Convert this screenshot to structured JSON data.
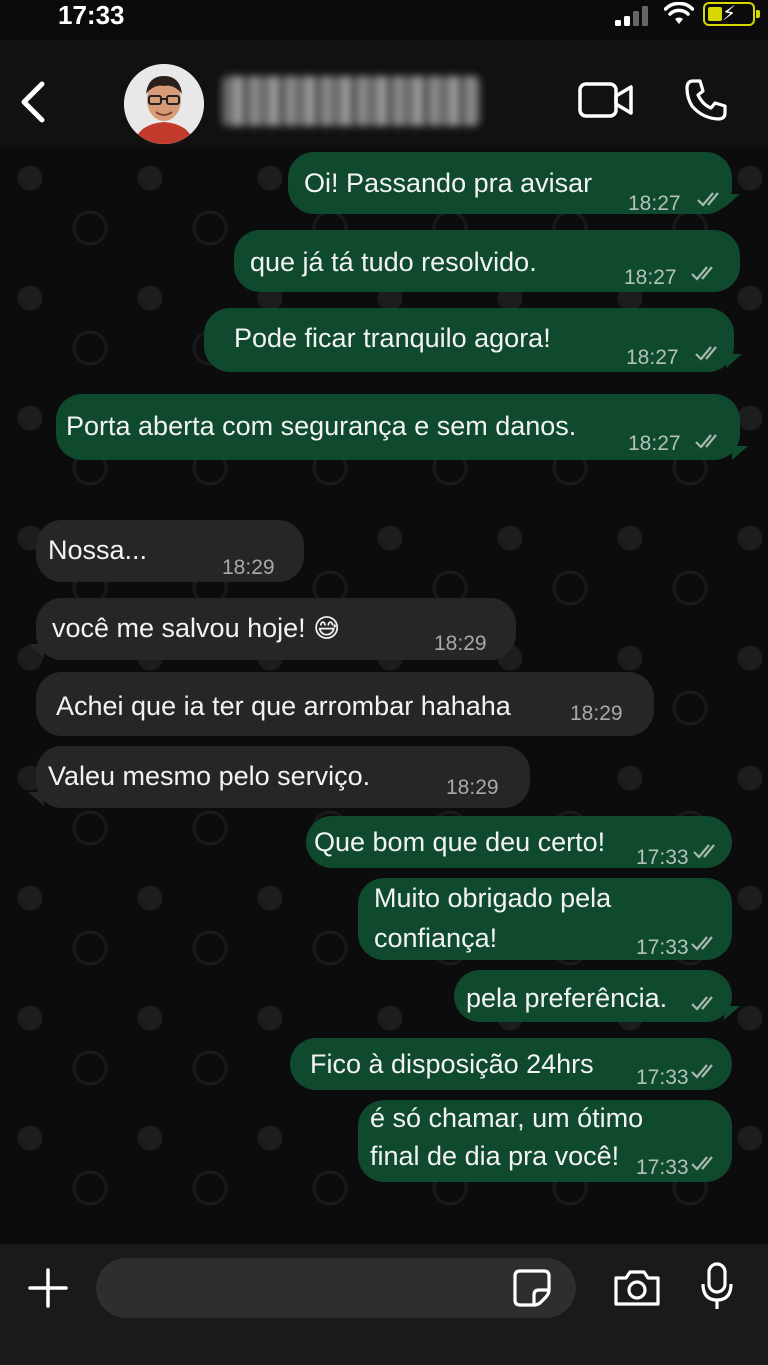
{
  "status_bar": {
    "time": "17:33"
  },
  "header": {
    "contact_name": ""
  },
  "messages": [
    {
      "dir": "out",
      "text": "Oi! Passando pra avisar",
      "time": "18:27"
    },
    {
      "dir": "out",
      "text": "que já tá tudo resolvido.",
      "time": "18:27"
    },
    {
      "dir": "out",
      "text": "Pode ficar tranquilo agora!",
      "time": "18:27"
    },
    {
      "dir": "out",
      "text": "Porta aberta com segurança e sem danos.",
      "time": "18:27"
    },
    {
      "dir": "in",
      "text": "Nossa...",
      "time": "18:29"
    },
    {
      "dir": "in",
      "text": "você me salvou hoje!",
      "emoji": "😅",
      "time": "18:29"
    },
    {
      "dir": "in",
      "text": "Achei que ia ter que arrombar hahaha",
      "time": "18:29"
    },
    {
      "dir": "in",
      "text": "Valeu mesmo pelo serviço.",
      "time": "18:29"
    },
    {
      "dir": "out",
      "text": "Que bom que deu certo!",
      "time": "17:33"
    },
    {
      "dir": "out",
      "text_line1": "Muito obrigado pela",
      "text_line2": "confiança!",
      "time": "17:33"
    },
    {
      "dir": "out",
      "text": "pela preferência.",
      "time": ""
    },
    {
      "dir": "out",
      "text": "Fico à disposição 24hrs",
      "time": "17:33"
    },
    {
      "dir": "out",
      "text_line1": "é só chamar, um ótimo",
      "text_line2": "final de dia pra você!",
      "time": "17:33"
    }
  ],
  "composer": {
    "input_value": ""
  },
  "colors": {
    "outgoing_bubble": "#0f4a2e",
    "incoming_bubble": "#262626",
    "background": "#0c0c0c"
  }
}
